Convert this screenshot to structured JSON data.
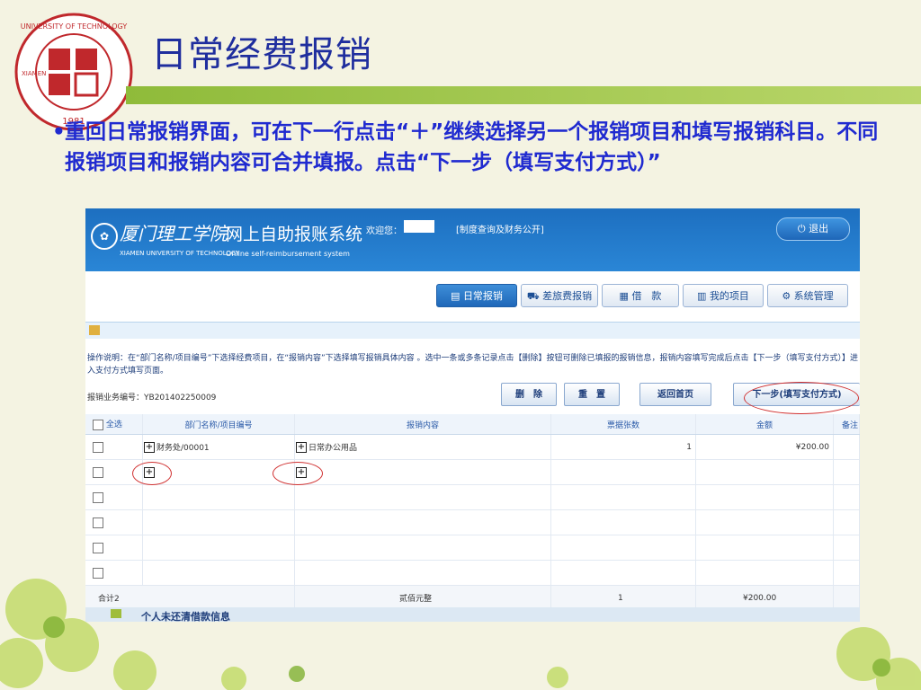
{
  "slide": {
    "title": "日常经费报销",
    "seal": {
      "top_text": "UNIVERSITY OF TECHNOLOGY",
      "left_text": "XIAMEN",
      "year": "1981"
    },
    "bullet_dot": "•",
    "bullet_text": "重回日常报销界面，可在下一行点击“＋”继续选择另一个报销项目和填写报销科目。不同报销项目和报销内容可合并填报。点击“下一步（填写支付方式）”"
  },
  "app": {
    "logo_cn": "厦门理工学院",
    "logo_en": "XIAMEN UNIVERSITY OF TECHNOLOGY",
    "system_title": "网上自助报账系统",
    "system_sub": "Online self-reimbursement system",
    "welcome": "欢迎您：",
    "policy_link": "[制度查询及财务公开]",
    "logout": "退出",
    "nav": [
      "日常报销",
      "差旅费报销",
      "借　款",
      "我的项目",
      "系统管理"
    ],
    "instructions": "操作说明：在“部门名称/项目编号”下选择经费项目，在“报销内容”下选择填写报销具体内容 。选中一条或多条记录点击【删除】按钮可删除已填报的报销信息，报销内容填写完成后点击【下一步（填写支付方式）】进入支付方式填写页面。",
    "biz_no_label": "报销业务编号：",
    "biz_no": "YB201402250009",
    "actions": {
      "delete": "删　除",
      "reset": "重　置",
      "home": "返回首页",
      "next": "下一步(填写支付方式)"
    },
    "table": {
      "select_all": "全选",
      "headers": [
        "部门名称/项目编号",
        "报销内容",
        "票据张数",
        "金额",
        "备注"
      ],
      "row1": {
        "dept": "财务处/00001",
        "content": "日常办公用品",
        "count": "1",
        "amount": "¥200.00"
      },
      "total": {
        "label": "合计2",
        "amount_cn": "贰佰元整",
        "count": "1",
        "amount": "¥200.00"
      }
    },
    "debt_label": "个人未还清借款信息"
  },
  "colors": {
    "title_blue": "#1f2e9e",
    "bullet_blue": "#1f2ad0",
    "header_blue": "#1d6fc0",
    "accent_green": "#8fbb3a"
  }
}
